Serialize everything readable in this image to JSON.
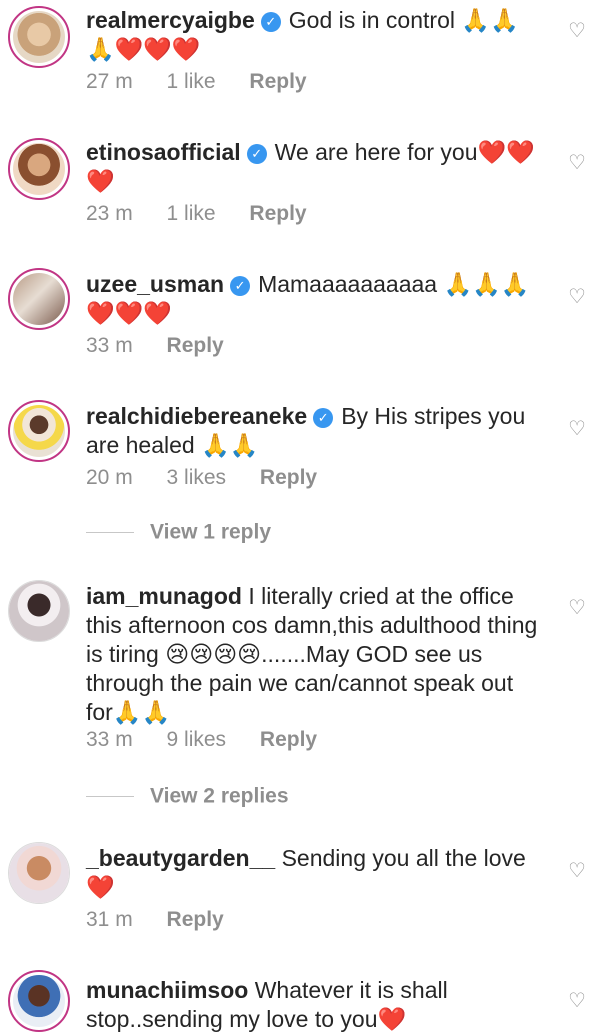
{
  "comments": [
    {
      "username": "realmercyaigbe",
      "verified": true,
      "text": "God is in control 🙏🙏 🙏❤️❤️❤️",
      "time": "27 m",
      "likes": "1 like",
      "reply": "Reply"
    },
    {
      "username": "etinosaofficial",
      "verified": true,
      "text": "We are here for you❤️❤️ ❤️",
      "time": "23 m",
      "likes": "1 like",
      "reply": "Reply"
    },
    {
      "username": "uzee_usman",
      "verified": true,
      "text": "Mamaaaaaaaaaa 🙏🙏🙏 ❤️❤️❤️",
      "time": "33 m",
      "likes": "",
      "reply": "Reply"
    },
    {
      "username": "realchidiebereaneke",
      "verified": true,
      "text": "By His stripes you are healed 🙏🙏",
      "time": "20 m",
      "likes": "3 likes",
      "reply": "Reply",
      "view_replies": "View 1 reply"
    },
    {
      "username": "iam_munagod",
      "verified": false,
      "text": "I literally cried at the office this afternoon cos damn,this adulthood thing is tiring 😢😢😢😢.......May GOD see us through the pain we can/cannot speak out for🙏🙏",
      "time": "33 m",
      "likes": "9 likes",
      "reply": "Reply",
      "view_replies": "View 2 replies"
    },
    {
      "username": "_beautygarden__",
      "verified": false,
      "text": "Sending you all the love ❤️",
      "time": "31 m",
      "likes": "",
      "reply": "Reply"
    },
    {
      "username": "munachiimsoo",
      "verified": false,
      "text": "Whatever it is shall stop..sending my love to you❤️",
      "time": "",
      "likes": "",
      "reply": ""
    }
  ],
  "icons": {
    "like": "heart-outline-icon",
    "verified": "verified-badge-icon"
  },
  "colors": {
    "verified": "#3897f0",
    "story_ring": "#c13584",
    "meta_text": "#8e8e8e"
  }
}
